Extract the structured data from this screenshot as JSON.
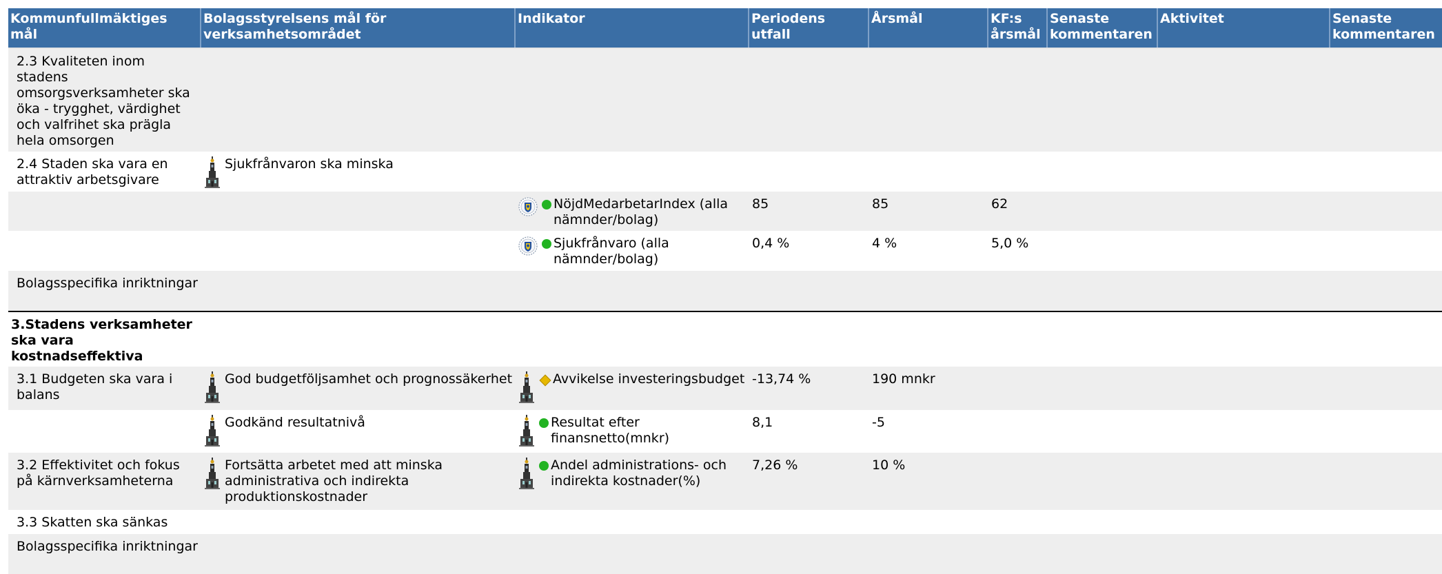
{
  "headers": [
    "Kommunfullmäktiges mål",
    "Bolagsstyrelsens mål för verksamhetsområdet",
    "Indikator",
    "Periodens utfall",
    "Årsmål",
    "KF:s årsmål",
    "Senaste kommentaren",
    "Aktivitet",
    "Senaste kommentaren"
  ],
  "rows": {
    "r1": {
      "goal": "2.3 Kvaliteten inom stadens omsorgsverksamheter ska öka - trygghet, värdighet och valfrihet ska prägla hela omsorgen"
    },
    "r2": {
      "goal": "2.4 Staden ska vara en attraktiv arbetsgivare",
      "board_goal": "Sjukfrånvaron ska minska"
    },
    "r3": {
      "indicator": "NöjdMedarbetarIndex (alla nämnder/bolag)",
      "outcome": "85",
      "target": "85",
      "kf_target": "62",
      "status": "green"
    },
    "r4": {
      "indicator": "Sjukfrånvaro (alla nämnder/bolag)",
      "outcome": "0,4 %",
      "target": "4 %",
      "kf_target": "5,0 %",
      "status": "green"
    },
    "r5": {
      "goal": "Bolagsspecifika inriktningar"
    },
    "r6": {
      "goal": "3.Stadens verksamheter ska vara kostnadseffektiva"
    },
    "r7": {
      "goal": "3.1 Budgeten ska vara i balans",
      "board_goal": "God budgetföljsamhet och prognossäkerhet",
      "indicator": "Avvikelse investeringsbudget",
      "outcome": "-13,74 %",
      "target": "190 mnkr",
      "status": "yellow"
    },
    "r8": {
      "board_goal": "Godkänd resultatnivå",
      "indicator": "Resultat efter finansnetto(mnkr)",
      "outcome": "8,1",
      "target": "-5",
      "status": "green"
    },
    "r9": {
      "goal": "3.2 Effektivitet och fokus på kärnverksamheterna",
      "board_goal": "Fortsätta arbetet med att minska administrativa och indirekta produktionskostnader",
      "indicator": "Andel administrations- och indirekta kostnader(%)",
      "outcome": "7,26 %",
      "target": "10 %",
      "status": "green"
    },
    "r10": {
      "goal": "3.3 Skatten ska sänkas"
    },
    "r11": {
      "goal": "Bolagsspecifika inriktningar"
    }
  },
  "colors": {
    "header_bg": "#3a6ea5",
    "row_alt": "#eeeeee",
    "status_green": "#22b322",
    "status_yellow": "#e6b800"
  },
  "icons": {
    "tower": "stadshus-tower-icon",
    "seal": "city-seal-icon"
  }
}
